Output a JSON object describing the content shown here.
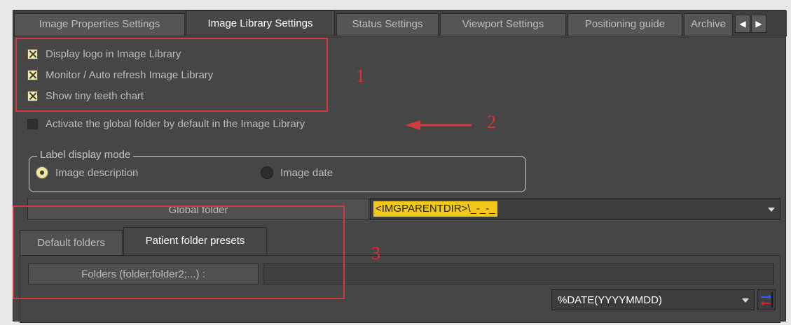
{
  "tabs": [
    {
      "label": "Image Properties Settings",
      "active": false
    },
    {
      "label": "Image Library Settings",
      "active": true
    },
    {
      "label": "Status Settings",
      "active": false
    },
    {
      "label": "Viewport Settings",
      "active": false
    },
    {
      "label": "Positioning guide",
      "active": false
    },
    {
      "label": "Archive",
      "active": false
    }
  ],
  "tab_scroll": {
    "left_icon": "arrow-left-icon",
    "right_icon": "arrow-right-icon"
  },
  "options": [
    {
      "label": "Display logo in Image Library",
      "checked": true
    },
    {
      "label": "Monitor / Auto refresh Image Library",
      "checked": true
    },
    {
      "label": "Show tiny teeth chart",
      "checked": true
    },
    {
      "label": "Activate the global folder by default in the Image Library",
      "checked": false
    }
  ],
  "label_display": {
    "title": "Label display mode",
    "options": [
      {
        "label": "Image description",
        "selected": true
      },
      {
        "label": "Image date",
        "selected": false
      }
    ]
  },
  "global_folder": {
    "label": "Global folder",
    "value": "<IMGPARENTDIR>\\_-_-_"
  },
  "subtabs": [
    {
      "label": "Default folders",
      "active": false
    },
    {
      "label": "Patient folder presets",
      "active": true
    }
  ],
  "folders": {
    "label": "Folders (folder;folder2;...) :",
    "value": ""
  },
  "date_pattern": {
    "value": "%DATE(YYYYMMDD)"
  },
  "annotations": {
    "one": "1",
    "two": "2",
    "three": "3"
  },
  "colors": {
    "accent": "#f2c81a",
    "annotation": "#d33a3a",
    "checkbox": "#f3e9a8"
  }
}
